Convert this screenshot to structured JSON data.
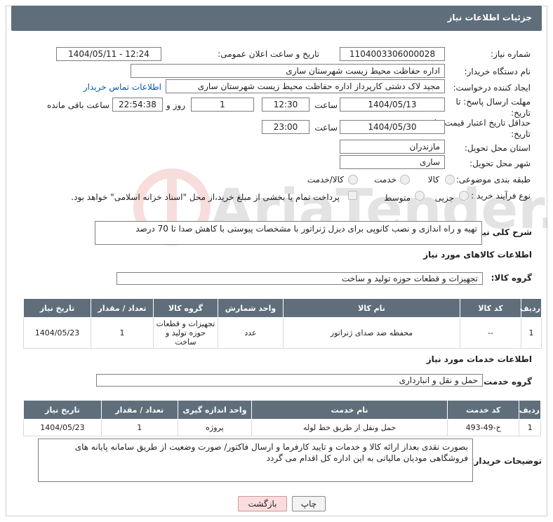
{
  "header": {
    "title": "جزئیات اطلاعات نیاز"
  },
  "form": {
    "need_number_label": "شماره نیاز:",
    "need_number": "1104003306000028",
    "announce_label": "تاریخ و ساعت اعلان عمومی:",
    "announce_value": "1404/05/11 - 12:24",
    "buyer_org_label": "نام دستگاه خریدار:",
    "buyer_org": "اداره حفاظت محیط زیست شهرستان ساری",
    "creator_label": "ایجاد کننده درخواست:",
    "creator": "مجید لاک دشتی کارپرداز اداره حفاظت محیط زیست شهرستان ساری",
    "contact_link": "اطلاعات تماس خریدار",
    "reply_deadline_label": "مهلت ارسال پاسخ: تا تاریخ:",
    "reply_date": "1404/05/13",
    "time_label": "ساعت",
    "reply_time": "12:30",
    "days_value": "1",
    "days_label": "روز و",
    "remaining_time": "22:54:38",
    "remaining_label": "ساعت باقی مانده",
    "price_validity_label": "حداقل تاریخ اعتبار قیمت: تا تاریخ:",
    "price_date": "1404/05/30",
    "price_time": "23:00",
    "province_label": "استان محل تحویل:",
    "province": "مازندران",
    "city_label": "شهر محل تحویل:",
    "city": "ساری",
    "category_label": "طبقه بندی موضوعی:",
    "category_options": [
      "کالا",
      "خدمت",
      "کالا/خدمت"
    ],
    "process_label": "نوع فرآیند خرید :",
    "process_options": [
      "جزیی",
      "متوسط"
    ],
    "payment_note": "پرداخت تمام یا بخشی از مبلغ خرید،از محل \"اسناد خزانه اسلامی\" خواهد بود."
  },
  "description": {
    "label": "شرح کلی نیاز:",
    "text": "تهیه و راه اندازی و نصب کانوپی برای دیزل ژنراتور با مشخصات پیوستی با کاهش صدا تا 70 درصد"
  },
  "goods": {
    "section_title": "اطلاعات کالاهای مورد نیاز",
    "group_label": "گروه کالا:",
    "group_value": "تجهیزات و قطعات حوزه تولید و ساخت",
    "columns": [
      "ردیف",
      "کد کالا",
      "نام کالا",
      "واحد شمارش",
      "گروه کالا",
      "تعداد / مقدار",
      "تاریخ نیاز"
    ],
    "rows": [
      [
        "1",
        "--",
        "محفظه ضد صدای ژنراتور",
        "عدد",
        "تجهیزات و قطعات حوزه تولید و ساخت",
        "1",
        "1404/05/23"
      ]
    ]
  },
  "services": {
    "section_title": "اطلاعات خدمات مورد نیاز",
    "group_label": "گروه خدمت:",
    "group_value": "حمل و نقل و انبارداری",
    "columns": [
      "ردیف",
      "کد خدمت",
      "نام خدمت",
      "واحد اندازه گیری",
      "تعداد / مقدار",
      "تاریخ نیاز"
    ],
    "rows": [
      [
        "1",
        "ح-49-493",
        "حمل ونقل از طریق خط لوله",
        "پروژه",
        "1",
        "1404/05/23"
      ]
    ]
  },
  "buyer_notes": {
    "label": "توضیحات خریدار:",
    "text": "بصورت نقدی بعداز ارائه کالا و خدمات  و تایید کارفرما و ارسال فاکتور/ صورت وضعیت از طریق سامانه پایانه های فروشگاهی مودیان مالیاتی به این اداره کل اقدام می گردد"
  },
  "buttons": {
    "print": "چاپ",
    "back": "بازگشت"
  },
  "watermark": {
    "text": "AriaTender.net"
  }
}
